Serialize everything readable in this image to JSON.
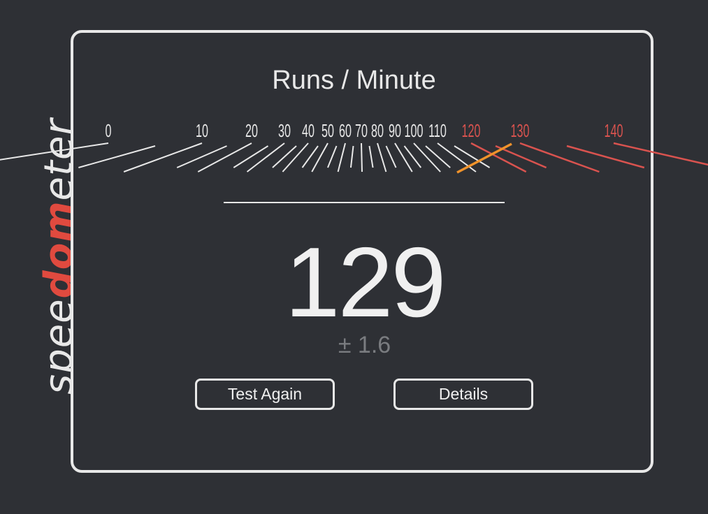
{
  "brand": {
    "logo_part1": "spee",
    "logo_part2": "do",
    "logo_part3": "m",
    "logo_part4": "eter",
    "accent_color": "#e04a3f"
  },
  "title": "Runs / Minute",
  "gauge": {
    "tick_labels": [
      "0",
      "10",
      "20",
      "30",
      "40",
      "50",
      "60",
      "70",
      "80",
      "90",
      "100",
      "110",
      "120",
      "130",
      "140"
    ],
    "red_zone_start": 120,
    "needle_value": 129,
    "needle_color": "#f0932b",
    "tick_color": "#e8e8e8",
    "red_color": "#d9534f"
  },
  "result": {
    "score": "129",
    "error": "± 1.6"
  },
  "buttons": {
    "test_again": "Test Again",
    "details": "Details"
  }
}
